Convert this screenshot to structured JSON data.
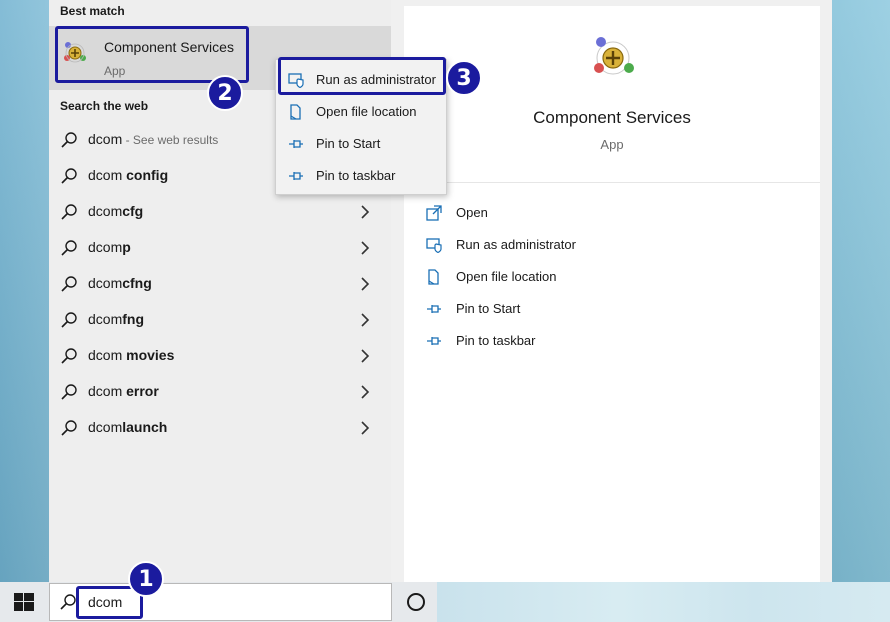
{
  "best_match": {
    "header": "Best match",
    "title": "Component Services",
    "subtitle": "App"
  },
  "search_web": {
    "header": "Search the web",
    "items": [
      {
        "prefix": "dcom",
        "bold": "",
        "suffix": " - See web results"
      },
      {
        "prefix": "dcom ",
        "bold": "config",
        "suffix": ""
      },
      {
        "prefix": "dcom",
        "bold": "cfg",
        "suffix": ""
      },
      {
        "prefix": "dcom",
        "bold": "p",
        "suffix": ""
      },
      {
        "prefix": "dcom",
        "bold": "cfng",
        "suffix": ""
      },
      {
        "prefix": "dcom",
        "bold": "fng",
        "suffix": ""
      },
      {
        "prefix": "dcom ",
        "bold": "movies",
        "suffix": ""
      },
      {
        "prefix": "dcom ",
        "bold": "error",
        "suffix": ""
      },
      {
        "prefix": "dcom",
        "bold": "launch",
        "suffix": ""
      }
    ]
  },
  "context_menu": {
    "items": [
      {
        "label": "Run as administrator",
        "icon": "shield-admin-icon"
      },
      {
        "label": "Open file location",
        "icon": "file-location-icon"
      },
      {
        "label": "Pin to Start",
        "icon": "pin-icon"
      },
      {
        "label": "Pin to taskbar",
        "icon": "pin-icon"
      }
    ]
  },
  "preview": {
    "title": "Component Services",
    "subtitle": "App",
    "actions": [
      {
        "label": "Open",
        "icon": "open-icon"
      },
      {
        "label": "Run as administrator",
        "icon": "shield-admin-icon"
      },
      {
        "label": "Open file location",
        "icon": "file-location-icon"
      },
      {
        "label": "Pin to Start",
        "icon": "pin-icon"
      },
      {
        "label": "Pin to taskbar",
        "icon": "pin-icon"
      }
    ]
  },
  "taskbar": {
    "search_text": "dcom"
  },
  "annotations": {
    "badge_1": "1",
    "badge_2": "2",
    "badge_3": "3"
  },
  "colors": {
    "annotation": "#1b1b9e",
    "accent_icon": "#1a6fb5"
  }
}
